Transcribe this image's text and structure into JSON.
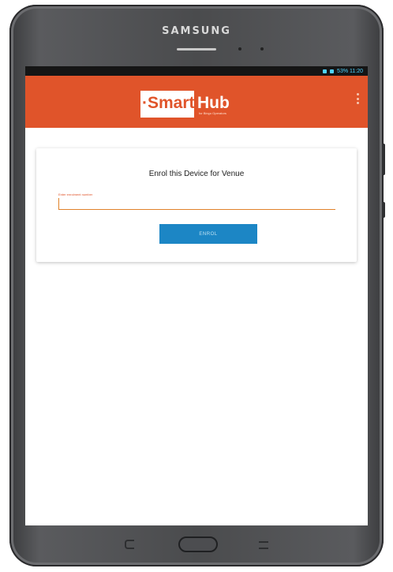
{
  "device": {
    "brand": "SAMSUNG"
  },
  "status_bar": {
    "text": "53% 11:20"
  },
  "app_bar": {
    "logo_prefix": "·Smart",
    "logo_suffix": "Hub",
    "logo_tagline": "for Bingo Operators",
    "accent_color": "#e0542a"
  },
  "enrol_card": {
    "title": "Enrol this Device for Venue",
    "field_label": "Enter enrolment number",
    "field_value": "",
    "button_label": "ENROL",
    "button_color": "#1c86c5"
  },
  "nav_bar": {
    "back_icon": "back-icon",
    "home_icon": "home-icon",
    "recent_icon": "recent-apps-icon"
  }
}
